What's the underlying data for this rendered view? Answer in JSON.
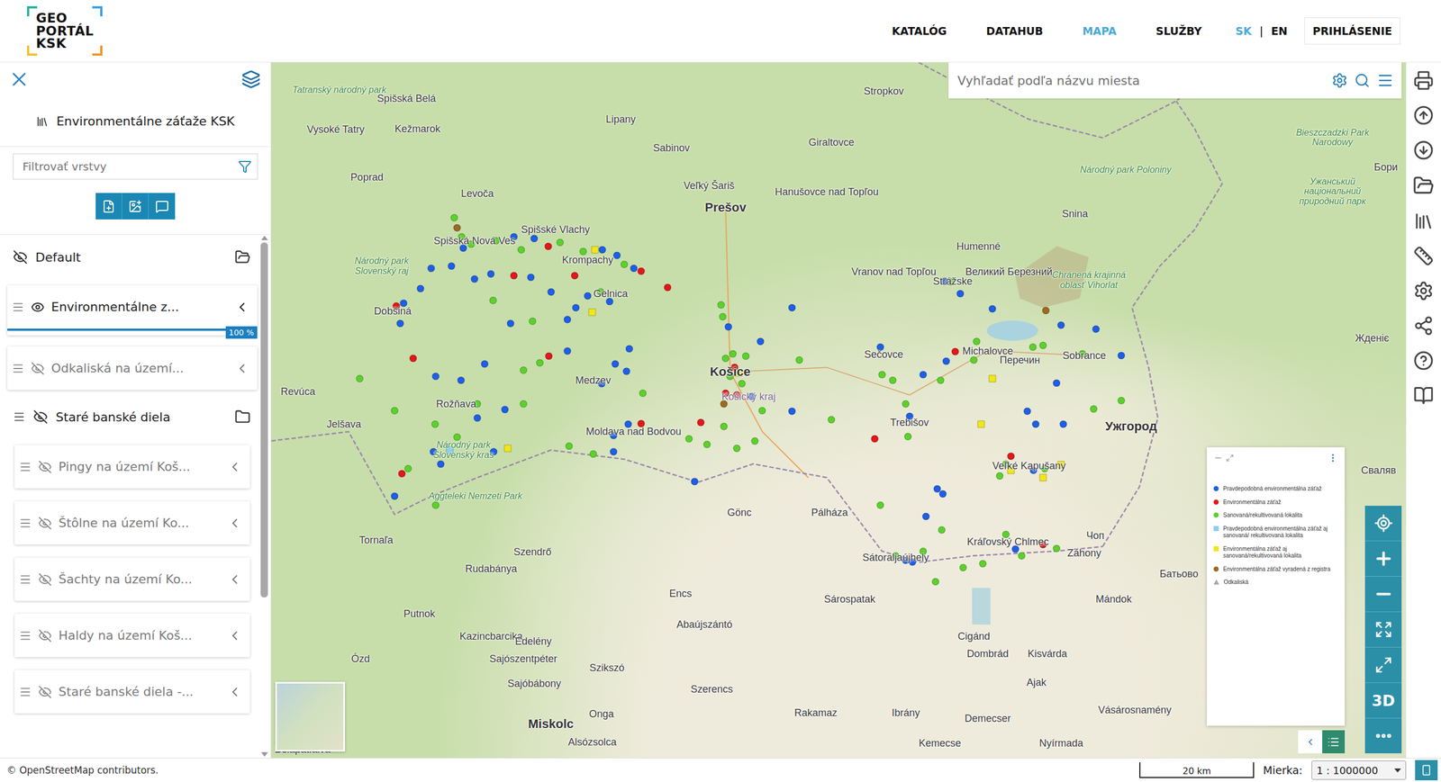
{
  "header": {
    "logo": [
      "GEO",
      "PORTÁL",
      "KSK"
    ],
    "nav": [
      {
        "label": "KATALÓG",
        "selected": false
      },
      {
        "label": "DATAHUB",
        "selected": false
      },
      {
        "label": "MAPA",
        "selected": true
      },
      {
        "label": "SLUŽBY",
        "selected": false
      }
    ],
    "languages": [
      {
        "label": "SK",
        "selected": true
      },
      {
        "label": "EN",
        "selected": false
      }
    ],
    "language_separator": "|",
    "login": "PRIHLÁSENIE"
  },
  "sidebar": {
    "title": "Environmentálne záťaže KSK",
    "filter": {
      "placeholder": "Filtrovať vrstvy"
    },
    "groups": [
      {
        "name": "Default",
        "visible": false,
        "layers": [
          {
            "name": "Environmentálne z...",
            "visible": true,
            "opacity": 1,
            "reading": "100 %"
          },
          {
            "name": "Odkaliská na území...",
            "visible": false
          }
        ]
      },
      {
        "name": "Staré banské diela",
        "visible": false,
        "layers": [
          {
            "name": "Pingy na území Koš...",
            "visible": false
          },
          {
            "name": "Štôlne na území Ko...",
            "visible": false
          },
          {
            "name": "Šachty na území Ko...",
            "visible": false
          },
          {
            "name": "Haldy na území Koš...",
            "visible": false
          },
          {
            "name": "Staré banské diela -...",
            "visible": false
          }
        ]
      }
    ]
  },
  "map": {
    "search": {
      "placeholder": "Vyhľadať podľa názvu miesta"
    },
    "three_d": "3D",
    "places": [
      {
        "name": "Tatranský národný park",
        "kind": "park"
      },
      {
        "name": "Spišská Belá",
        "kind": "town"
      },
      {
        "name": "Stropkov",
        "kind": "town"
      },
      {
        "name": "Lipany",
        "kind": "town"
      },
      {
        "name": "Kežmarok",
        "kind": "town"
      },
      {
        "name": "Vysoké Tatry",
        "kind": "town"
      },
      {
        "name": "Sabinov",
        "kind": "town"
      },
      {
        "name": "Giraltovce",
        "kind": "town"
      },
      {
        "name": "Poprad",
        "kind": "town"
      },
      {
        "name": "Levoča",
        "kind": "town"
      },
      {
        "name": "Veľký Šariš",
        "kind": "town"
      },
      {
        "name": "Hanušovce nad Topľou",
        "kind": "town"
      },
      {
        "name": "Prešov",
        "kind": "city"
      },
      {
        "name": "Humenné",
        "kind": "town"
      },
      {
        "name": "Snina",
        "kind": "town"
      },
      {
        "name": "Bieszczadzki Park Narodowy",
        "kind": "park"
      },
      {
        "name": "Národný park Poloniny",
        "kind": "park"
      },
      {
        "name": "Spišská Nová Ves",
        "kind": "town"
      },
      {
        "name": "Spišské Vlachy",
        "kind": "town"
      },
      {
        "name": "Krompachy",
        "kind": "town"
      },
      {
        "name": "Gelnica",
        "kind": "town"
      },
      {
        "name": "Dobšiná",
        "kind": "town"
      },
      {
        "name": "Národný park Slovenský raj",
        "kind": "park"
      },
      {
        "name": "Vranov nad Topľou",
        "kind": "town"
      },
      {
        "name": "Strážske",
        "kind": "town"
      },
      {
        "name": "Chránená krajinná oblasť Vihorlat",
        "kind": "park"
      },
      {
        "name": "Великий Березний",
        "kind": "town"
      },
      {
        "name": "Michalovce",
        "kind": "town"
      },
      {
        "name": "Sobrance",
        "kind": "town"
      },
      {
        "name": "Перечин",
        "kind": "town"
      },
      {
        "name": "Жденіє",
        "kind": "town"
      },
      {
        "name": "Revúca",
        "kind": "town"
      },
      {
        "name": "Rožňava",
        "kind": "town"
      },
      {
        "name": "Medzev",
        "kind": "town"
      },
      {
        "name": "Košice",
        "kind": "city"
      },
      {
        "name": "Košický kraj",
        "kind": "region"
      },
      {
        "name": "Sečovce",
        "kind": "town"
      },
      {
        "name": "Trebišov",
        "kind": "town"
      },
      {
        "name": "Jelšava",
        "kind": "town"
      },
      {
        "name": "Moldava nad Bodvou",
        "kind": "town"
      },
      {
        "name": "Ужгород",
        "kind": "city"
      },
      {
        "name": "Veľké Kapušany",
        "kind": "town"
      },
      {
        "name": "Národný park Slovenský kras",
        "kind": "park"
      },
      {
        "name": "Aggteleki Nemzeti Park",
        "kind": "park"
      },
      {
        "name": "Gönc",
        "kind": "town"
      },
      {
        "name": "Pálháza",
        "kind": "town"
      },
      {
        "name": "Tornaľa",
        "kind": "town"
      },
      {
        "name": "Szendrő",
        "kind": "town"
      },
      {
        "name": "Kráľovský Chlmec",
        "kind": "town"
      },
      {
        "name": "Sátoraljaújhely",
        "kind": "town"
      },
      {
        "name": "Záhony",
        "kind": "town"
      },
      {
        "name": "Чоп",
        "kind": "town"
      },
      {
        "name": "Rudabánya",
        "kind": "town"
      },
      {
        "name": "Encs",
        "kind": "town"
      },
      {
        "name": "Sárospatak",
        "kind": "town"
      },
      {
        "name": "Mándok",
        "kind": "town"
      },
      {
        "name": "Батьово",
        "kind": "town"
      },
      {
        "name": "Putnok",
        "kind": "town"
      },
      {
        "name": "Abaújszántó",
        "kind": "town"
      },
      {
        "name": "Kazincbarcika",
        "kind": "town"
      },
      {
        "name": "Edelény",
        "kind": "town"
      },
      {
        "name": "Cigánd",
        "kind": "town"
      },
      {
        "name": "Ózd",
        "kind": "town"
      },
      {
        "name": "Sajószentpéter",
        "kind": "town"
      },
      {
        "name": "Dombrád",
        "kind": "town"
      },
      {
        "name": "Kisvárda",
        "kind": "town"
      },
      {
        "name": "Szikszó",
        "kind": "town"
      },
      {
        "name": "Sajóbábony",
        "kind": "town"
      },
      {
        "name": "Ajak",
        "kind": "town"
      },
      {
        "name": "Szerencs",
        "kind": "town"
      },
      {
        "name": "Rakamaz",
        "kind": "town"
      },
      {
        "name": "Ibrány",
        "kind": "town"
      },
      {
        "name": "Demecser",
        "kind": "town"
      },
      {
        "name": "Vásárosnamény",
        "kind": "town"
      },
      {
        "name": "Miskolc",
        "kind": "city"
      },
      {
        "name": "Onga",
        "kind": "town"
      },
      {
        "name": "Alsózsolca",
        "kind": "town"
      },
      {
        "name": "Kemecse",
        "kind": "town"
      },
      {
        "name": "Nyírmada",
        "kind": "town"
      },
      {
        "name": "Bélapátfalva",
        "kind": "town"
      },
      {
        "name": "Ужанський національний природний парк",
        "kind": "park"
      },
      {
        "name": "Сваляв",
        "kind": "town"
      },
      {
        "name": "Бори",
        "kind": "town"
      }
    ],
    "pins": [
      {
        "color": "#5cd12c",
        "kind": "dot"
      },
      {
        "color": "#9b6a22",
        "kind": "dot"
      },
      {
        "color": "#5cd12c",
        "kind": "dot"
      },
      {
        "color": "#5cd12c",
        "kind": "dot"
      },
      {
        "color": "#1f5fe6",
        "kind": "dot"
      },
      {
        "color": "#5cd12c",
        "kind": "dot"
      },
      {
        "color": "#1f5fe6",
        "kind": "dot"
      },
      {
        "color": "#5cd12c",
        "kind": "dot"
      },
      {
        "color": "#1f5fe6",
        "kind": "dot"
      },
      {
        "color": "#e3171b",
        "kind": "dot"
      },
      {
        "color": "#5cd12c",
        "kind": "dot"
      },
      {
        "color": "#5cd12c",
        "kind": "dot"
      },
      {
        "color": "#f2e61a",
        "kind": "square"
      },
      {
        "color": "#1f5fe6",
        "kind": "dot"
      },
      {
        "color": "#1f5fe6",
        "kind": "dot"
      },
      {
        "color": "#5cd12c",
        "kind": "dot"
      },
      {
        "color": "#1f5fe6",
        "kind": "dot"
      },
      {
        "color": "#e3171b",
        "kind": "dot"
      },
      {
        "color": "#e3171b",
        "kind": "dot"
      },
      {
        "color": "#e3171b",
        "kind": "dot"
      },
      {
        "color": "#e3171b",
        "kind": "dot"
      },
      {
        "color": "#1f5fe6",
        "kind": "dot"
      },
      {
        "color": "#1f5fe6",
        "kind": "dot"
      },
      {
        "color": "#1f5fe6",
        "kind": "dot"
      },
      {
        "color": "#1f5fe6",
        "kind": "dot"
      },
      {
        "color": "#1f5fe6",
        "kind": "dot"
      },
      {
        "color": "#1f5fe6",
        "kind": "dot"
      },
      {
        "color": "#1f5fe6",
        "kind": "dot"
      },
      {
        "color": "#1f5fe6",
        "kind": "dot"
      },
      {
        "color": "#5cd12c",
        "kind": "dot"
      },
      {
        "color": "#1f5fe6",
        "kind": "dot"
      },
      {
        "color": "#1f5fe6",
        "kind": "dot"
      },
      {
        "color": "#1f5fe6",
        "kind": "dot"
      },
      {
        "color": "#f2e61a",
        "kind": "square"
      },
      {
        "color": "#5cd12c",
        "kind": "dot"
      },
      {
        "color": "#1f5fe6",
        "kind": "dot"
      },
      {
        "color": "#5cd12c",
        "kind": "dot"
      },
      {
        "color": "#e3171b",
        "kind": "dot"
      },
      {
        "color": "#5cd12c",
        "kind": "dot"
      },
      {
        "color": "#5cd12c",
        "kind": "dot"
      },
      {
        "color": "#1f5fe6",
        "kind": "dot"
      },
      {
        "color": "#1f5fe6",
        "kind": "dot"
      },
      {
        "color": "#1f5fe6",
        "kind": "dot"
      },
      {
        "color": "#1f5fe6",
        "kind": "dot"
      },
      {
        "color": "#1f5fe6",
        "kind": "dot"
      },
      {
        "color": "#5cd12c",
        "kind": "dot"
      },
      {
        "color": "#e3171b",
        "kind": "dot"
      },
      {
        "color": "#1f5fe6",
        "kind": "dot"
      },
      {
        "color": "#1f5fe6",
        "kind": "dot"
      },
      {
        "color": "#e3171b",
        "kind": "dot"
      },
      {
        "color": "#5cd12c",
        "kind": "dot"
      },
      {
        "color": "#1f5fe6",
        "kind": "dot"
      },
      {
        "color": "#1f5fe6",
        "kind": "dot"
      },
      {
        "color": "#1f5fe6",
        "kind": "dot"
      },
      {
        "color": "#5cd12c",
        "kind": "dot"
      },
      {
        "color": "#1f5fe6",
        "kind": "dot"
      },
      {
        "color": "#1f5fe6",
        "kind": "dot"
      },
      {
        "color": "#5cd12c",
        "kind": "dot"
      },
      {
        "color": "#5cd12c",
        "kind": "dot"
      },
      {
        "color": "#5cd12c",
        "kind": "dot"
      },
      {
        "color": "#5cd12c",
        "kind": "dot"
      },
      {
        "color": "#1f5fe6",
        "kind": "dot"
      },
      {
        "color": "#8ad0f0",
        "kind": "square"
      },
      {
        "color": "#1f5fe6",
        "kind": "dot"
      },
      {
        "color": "#5cd12c",
        "kind": "dot"
      },
      {
        "color": "#e3171b",
        "kind": "dot"
      },
      {
        "color": "#1f5fe6",
        "kind": "dot"
      },
      {
        "color": "#5cd12c",
        "kind": "dot"
      },
      {
        "color": "#1f5fe6",
        "kind": "dot"
      },
      {
        "color": "#f2e61a",
        "kind": "square"
      },
      {
        "color": "#5cd12c",
        "kind": "dot"
      },
      {
        "color": "#5cd12c",
        "kind": "dot"
      },
      {
        "color": "#1f5fe6",
        "kind": "dot"
      },
      {
        "color": "#1f5fe6",
        "kind": "dot"
      },
      {
        "color": "#e3171b",
        "kind": "dot"
      },
      {
        "color": "#1f5fe6",
        "kind": "dot"
      },
      {
        "color": "#5cd12c",
        "kind": "dot"
      },
      {
        "color": "#e3171b",
        "kind": "dot"
      },
      {
        "color": "#5cd12c",
        "kind": "dot"
      },
      {
        "color": "#1f5fe6",
        "kind": "dot"
      },
      {
        "color": "#5cd12c",
        "kind": "dot"
      },
      {
        "color": "#5cd12c",
        "kind": "dot"
      },
      {
        "color": "#5cd12c",
        "kind": "dot"
      },
      {
        "color": "#e3171b",
        "kind": "dot"
      },
      {
        "color": "#5cd12c",
        "kind": "dot"
      },
      {
        "color": "#5cd12c",
        "kind": "dot"
      },
      {
        "color": "#1f5fe6",
        "kind": "dot"
      },
      {
        "color": "#5cd12c",
        "kind": "dot"
      },
      {
        "color": "#5cd12c",
        "kind": "dot"
      },
      {
        "color": "#5cd12c",
        "kind": "dot"
      },
      {
        "color": "#5cd12c",
        "kind": "dot"
      },
      {
        "color": "#e3171b",
        "kind": "dot"
      },
      {
        "color": "#f2e61a",
        "kind": "square"
      },
      {
        "color": "#5cd12c",
        "kind": "dot"
      },
      {
        "color": "#e3171b",
        "kind": "dot"
      },
      {
        "color": "#9b6a22",
        "kind": "dot"
      },
      {
        "color": "#5cd12c",
        "kind": "dot"
      },
      {
        "color": "#1f5fe6",
        "kind": "dot"
      },
      {
        "color": "#1f5fe6",
        "kind": "dot"
      },
      {
        "color": "#1f5fe6",
        "kind": "dot"
      },
      {
        "color": "#5cd12c",
        "kind": "dot"
      },
      {
        "color": "#1f5fe6",
        "kind": "dot"
      },
      {
        "color": "#5cd12c",
        "kind": "dot"
      },
      {
        "color": "#1f5fe6",
        "kind": "dot"
      },
      {
        "color": "#5cd12c",
        "kind": "dot"
      },
      {
        "color": "#1f5fe6",
        "kind": "dot"
      },
      {
        "color": "#1f5fe6",
        "kind": "dot"
      },
      {
        "color": "#9b6a22",
        "kind": "dot"
      },
      {
        "color": "#1f5fe6",
        "kind": "dot"
      },
      {
        "color": "#1f5fe6",
        "kind": "dot"
      },
      {
        "color": "#5cd12c",
        "kind": "dot"
      },
      {
        "color": "#5cd12c",
        "kind": "dot"
      },
      {
        "color": "#5cd12c",
        "kind": "dot"
      },
      {
        "color": "#e3171b",
        "kind": "dot"
      },
      {
        "color": "#5cd12c",
        "kind": "dot"
      },
      {
        "color": "#1f5fe6",
        "kind": "dot"
      },
      {
        "color": "#1f5fe6",
        "kind": "dot"
      },
      {
        "color": "#1f5fe6",
        "kind": "dot"
      },
      {
        "color": "#5cd12c",
        "kind": "dot"
      },
      {
        "color": "#5cd12c",
        "kind": "dot"
      },
      {
        "color": "#5cd12c",
        "kind": "dot"
      },
      {
        "color": "#f2e61a",
        "kind": "square"
      },
      {
        "color": "#5cd12c",
        "kind": "dot"
      },
      {
        "color": "#1f5fe6",
        "kind": "dot"
      },
      {
        "color": "#1f5fe6",
        "kind": "dot"
      },
      {
        "color": "#5cd12c",
        "kind": "dot"
      },
      {
        "color": "#5cd12c",
        "kind": "dot"
      },
      {
        "color": "#1f5fe6",
        "kind": "dot"
      },
      {
        "color": "#1f5fe6",
        "kind": "dot"
      },
      {
        "color": "#1f5fe6",
        "kind": "dot"
      },
      {
        "color": "#f2e61a",
        "kind": "square"
      },
      {
        "color": "#5cd12c",
        "kind": "dot"
      },
      {
        "color": "#1f5fe6",
        "kind": "dot"
      },
      {
        "color": "#5cd12c",
        "kind": "dot"
      },
      {
        "color": "#e3171b",
        "kind": "dot"
      },
      {
        "color": "#e3171b",
        "kind": "dot"
      },
      {
        "color": "#5cd12c",
        "kind": "dot"
      },
      {
        "color": "#f2e61a",
        "kind": "square"
      },
      {
        "color": "#5cd12c",
        "kind": "dot"
      },
      {
        "color": "#1f5fe6",
        "kind": "dot"
      },
      {
        "color": "#f2e61a",
        "kind": "square"
      },
      {
        "color": "#5cd12c",
        "kind": "dot"
      },
      {
        "color": "#f2e61a",
        "kind": "square"
      },
      {
        "color": "#1f5fe6",
        "kind": "dot"
      },
      {
        "color": "#1f5fe6",
        "kind": "dot"
      },
      {
        "color": "#1f5fe6",
        "kind": "dot"
      },
      {
        "color": "#5cd12c",
        "kind": "dot"
      },
      {
        "color": "#5cd12c",
        "kind": "dot"
      },
      {
        "color": "#5cd12c",
        "kind": "dot"
      },
      {
        "color": "#1f5fe6",
        "kind": "dot"
      },
      {
        "color": "#5cd12c",
        "kind": "dot"
      },
      {
        "color": "#e3171b",
        "kind": "dot"
      },
      {
        "color": "#5cd12c",
        "kind": "dot"
      },
      {
        "color": "#5cd12c",
        "kind": "dot"
      },
      {
        "color": "#5cd12c",
        "kind": "dot"
      },
      {
        "color": "#5cd12c",
        "kind": "dot"
      },
      {
        "color": "#5cd12c",
        "kind": "dot"
      },
      {
        "color": "#5cd12c",
        "kind": "dot"
      },
      {
        "color": "#1f5fe6",
        "kind": "dot"
      },
      {
        "color": "#1f5fe6",
        "kind": "dot"
      }
    ],
    "legend": {
      "items": [
        {
          "label": "Pravdepodobná environmentálna záťaž",
          "color": "#1f5fe6",
          "kind": "dot"
        },
        {
          "label": "Environmentálna záťaž",
          "color": "#e3171b",
          "kind": "dot"
        },
        {
          "label": "Sanovaná/rekultivovaná lokalita",
          "color": "#5cd12c",
          "kind": "dot"
        },
        {
          "label": "Pravdepodobná environmentálna záťaž aj sanovaná/ rekultivovaná lokalita",
          "color": "#8ad0f0",
          "kind": "square"
        },
        {
          "label": "Environmentálna záťaž aj sanovaná/rekultivovaná lokalita",
          "color": "#f2e61a",
          "kind": "square"
        },
        {
          "label": "Environmentálna záťaž vyradená z registra",
          "color": "#9b6a22",
          "kind": "dot"
        },
        {
          "label": "Odkaliská",
          "color": "#a8a8a8",
          "kind": "triangle"
        }
      ]
    }
  },
  "status_bar": {
    "attribution": "© OpenStreetMap contributors.",
    "scale": "20 km",
    "scale_label": "Mierka:",
    "scale_value": "1 : 1000000"
  }
}
